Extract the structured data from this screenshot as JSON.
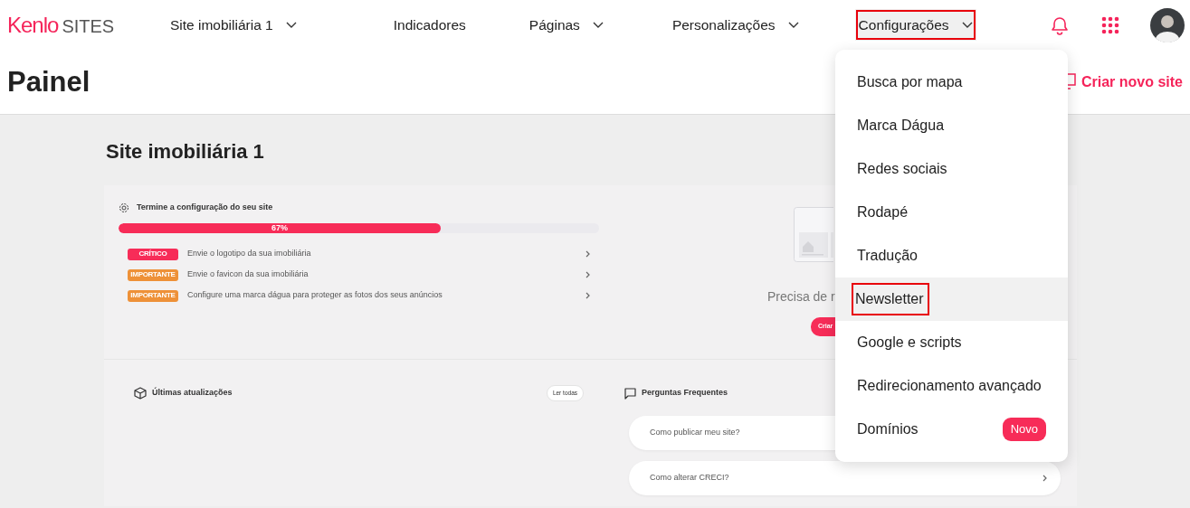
{
  "header": {
    "logo": {
      "brand": "Kenlo",
      "product": "SITES"
    },
    "nav": [
      {
        "label": "Site imobiliária 1",
        "has_dropdown": true,
        "open": false,
        "outlined": false
      },
      {
        "label": "Indicadores",
        "has_dropdown": false,
        "open": false,
        "outlined": false
      },
      {
        "label": "Páginas",
        "has_dropdown": true,
        "open": false,
        "outlined": false
      },
      {
        "label": "Personalizações",
        "has_dropdown": true,
        "open": false,
        "outlined": false
      },
      {
        "label": "Configurações",
        "has_dropdown": true,
        "open": true,
        "outlined": true
      }
    ]
  },
  "page_title": "Painel",
  "create_site": "Criar novo site",
  "site": {
    "title": "Site imobiliária 1",
    "setup": {
      "title": "Termine a configuração do seu site",
      "progress": {
        "level": 0.67,
        "reading": "67%"
      },
      "tasks": [
        {
          "tag": "CRÍTICO",
          "kind": "critical",
          "text": "Envie o logotipo da sua imobiliária"
        },
        {
          "tag": "IMPORTANTE",
          "kind": "important",
          "text": "Envie o favicon da sua imobiliária"
        },
        {
          "tag": "IMPORTANTE",
          "kind": "important",
          "text": "Configure uma marca dágua para proteger as fotos dos seus anúncios"
        }
      ]
    },
    "promo": {
      "text": "Precisa de r",
      "button": "Criar"
    },
    "updates": {
      "title": "Últimas atualizações",
      "button": "Ler todas"
    },
    "faq": {
      "title": "Perguntas Frequentes",
      "items": [
        "Como publicar meu site?",
        "Como alterar CRECI?"
      ]
    }
  },
  "menu": {
    "items": [
      {
        "label": "Busca por mapa",
        "selected": false,
        "outlined": false
      },
      {
        "label": "Marca Dágua",
        "selected": false,
        "outlined": false
      },
      {
        "label": "Redes sociais",
        "selected": false,
        "outlined": false
      },
      {
        "label": "Rodapé",
        "selected": false,
        "outlined": false
      },
      {
        "label": "Tradução",
        "selected": false,
        "outlined": false
      },
      {
        "label": "Newsletter",
        "selected": true,
        "outlined": true
      },
      {
        "label": "Google e scripts",
        "selected": false,
        "outlined": false
      },
      {
        "label": "Redirecionamento avançado",
        "selected": false,
        "outlined": false
      },
      {
        "label": "Domínios",
        "selected": false,
        "outlined": false,
        "badge": "Novo"
      }
    ]
  }
}
